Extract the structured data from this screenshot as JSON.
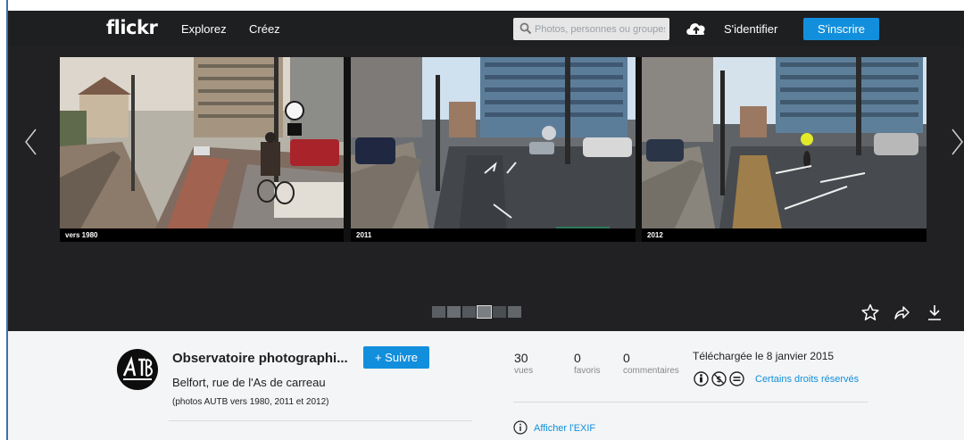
{
  "header": {
    "logo": "flickr",
    "nav": [
      "Explorez",
      "Créez"
    ],
    "search_placeholder": "Photos, personnes ou groupes",
    "signin": "S'identifier",
    "signup": "S'inscrire"
  },
  "photo": {
    "captions": [
      "vers 1980",
      "2011",
      "2012"
    ]
  },
  "author": {
    "name": "Observatoire photographi...",
    "follow": "+ Suivre"
  },
  "photo_info": {
    "title": "Belfort, rue de l'As de carreau",
    "description": "(photos AUTB vers 1980, 2011 et 2012)"
  },
  "stats": [
    {
      "value": "30",
      "label": "vues"
    },
    {
      "value": "0",
      "label": "favoris"
    },
    {
      "value": "0",
      "label": "commentaires"
    }
  ],
  "uploaded": "Téléchargée le 8 janvier 2015",
  "license": "Certains droits réservés",
  "exif": "Afficher l'EXIF",
  "colors": {
    "accent": "#128fdc",
    "header_bg": "#1e1f20",
    "viewer_bg": "#212124"
  }
}
